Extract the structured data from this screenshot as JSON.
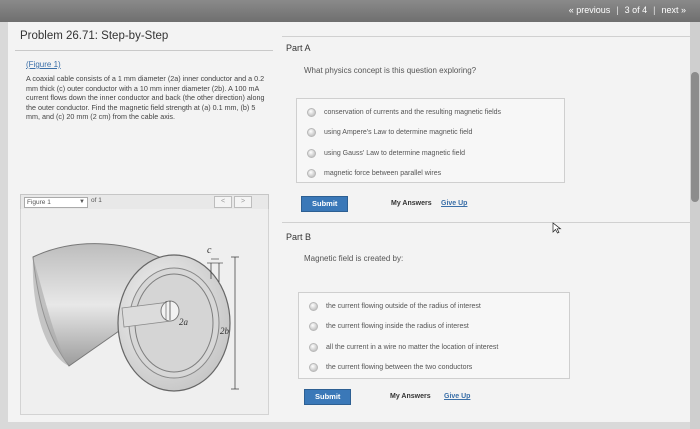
{
  "pager": {
    "previous": "« previous",
    "position": "3 of 4",
    "next": "next »"
  },
  "problem": {
    "title": "Problem 26.71: Step-by-Step",
    "figure_link": "(Figure 1)",
    "text": "A coaxial cable consists of a 1 mm diameter (2a) inner conductor and a 0.2 mm thick (c) outer conductor with a 10 mm inner diameter (2b). A 100 mA current flows down the inner conductor and back (the other direction) along the outer conductor. Find the magnetic field strength at (a) 0.1 mm, (b) 5 mm, and (c) 20 mm (2 cm) from the cable axis."
  },
  "figure": {
    "selected": "Figure 1",
    "of": "of 1",
    "prev": "<",
    "next": ">",
    "labels": {
      "c": "c",
      "a": "2a",
      "b": "2b"
    }
  },
  "partA": {
    "label": "Part A",
    "question": "What physics concept is this question exploring?",
    "options": [
      "conservation of currents and the resulting magnetic fields",
      "using Ampere's Law to determine magnetic field",
      "using Gauss' Law to determine magnetic field",
      "magnetic force between parallel wires"
    ],
    "submit": "Submit",
    "my_answers": "My Answers",
    "give_up": "Give Up"
  },
  "partB": {
    "label": "Part B",
    "question": "Magnetic field is created by:",
    "options": [
      "the current flowing outside of the radius of interest",
      "the current flowing inside the radius of interest",
      "all the current in a wire no matter the location of interest",
      "the current flowing between the two conductors"
    ],
    "submit": "Submit",
    "my_answers": "My Answers",
    "give_up": "Give Up"
  }
}
